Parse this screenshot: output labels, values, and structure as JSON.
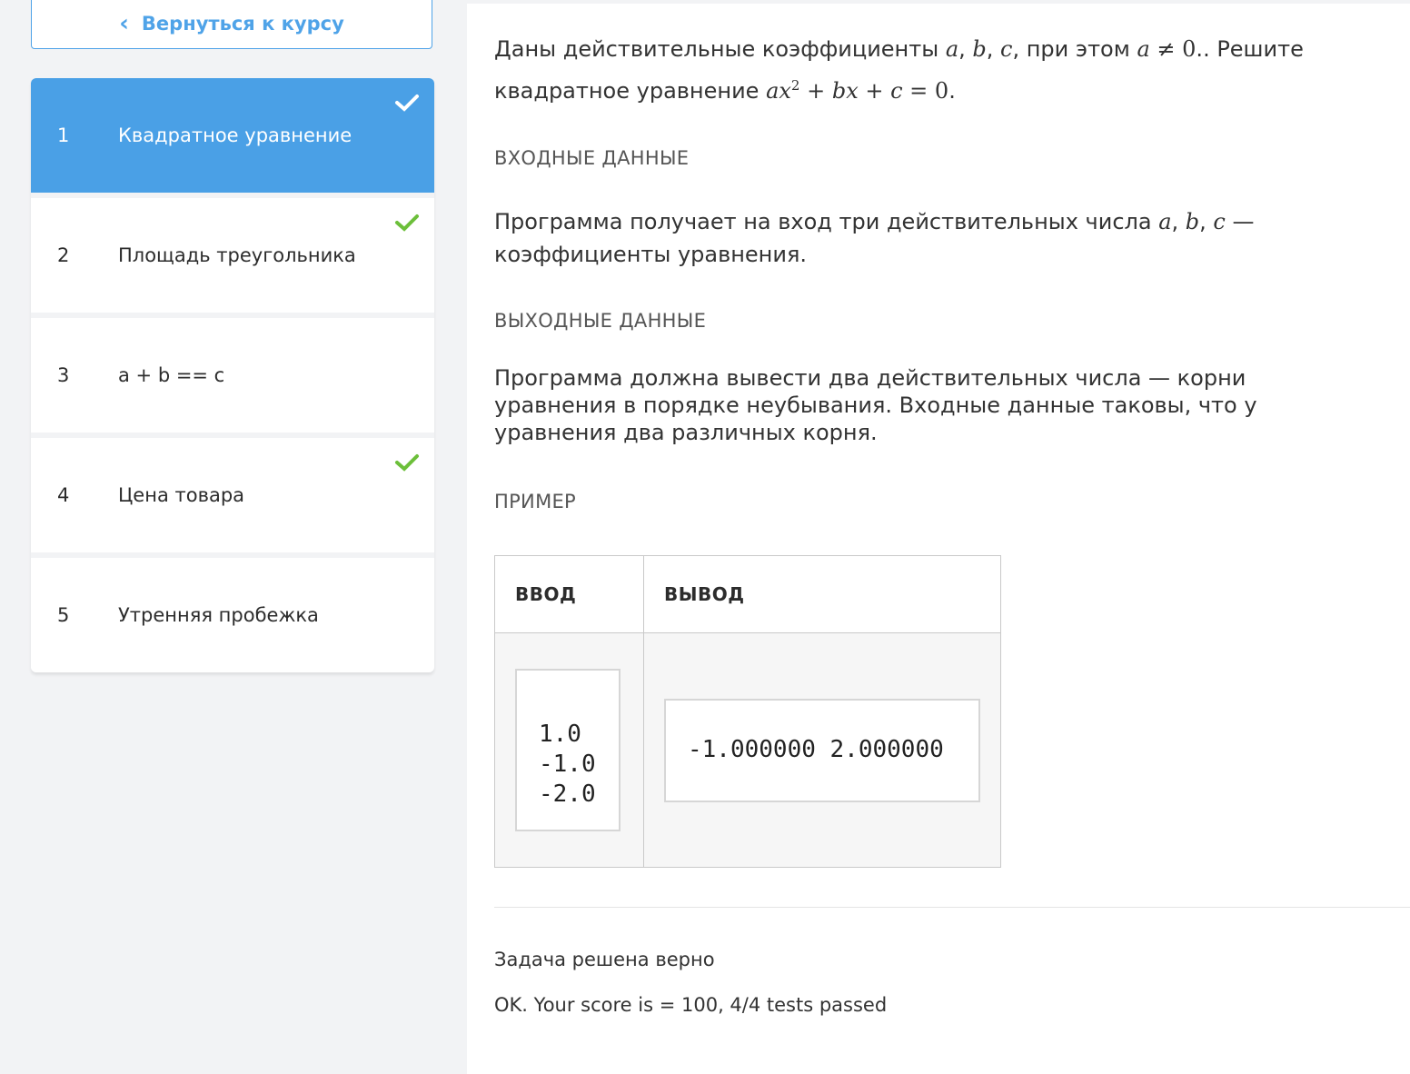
{
  "sidebar": {
    "back_label": "Вернуться к курсу",
    "items": [
      {
        "num": "1",
        "title": "Квадратное уравнение",
        "done": true,
        "active": true
      },
      {
        "num": "2",
        "title": "Площадь треугольника",
        "done": true,
        "active": false
      },
      {
        "num": "3",
        "title": "a + b == c",
        "done": false,
        "active": false
      },
      {
        "num": "4",
        "title": "Цена товара",
        "done": true,
        "active": false
      },
      {
        "num": "5",
        "title": "Утренняя пробежка",
        "done": false,
        "active": false
      }
    ]
  },
  "problem": {
    "statement_prefix": "Даны действительные коэффициенты ",
    "statement_mid": ", при этом ",
    "statement_suffix": ". Решите квадратное уравнение ",
    "input_title": "ВХОДНЫЕ ДАННЫЕ",
    "input_text_prefix": "Программа получает на вход три действительных числа ",
    "input_text_suffix": " — коэффициенты уравнения.",
    "output_title": "ВЫХОДНЫЕ ДАННЫЕ",
    "output_text": "Программа должна вывести два действительных числа — корни уравнения в порядке неубывания. Входные данные таковы, что у уравнения два различных корня.",
    "example_title": "ПРИМЕР",
    "example": {
      "col_in": "ВВОД",
      "col_out": "ВЫВОД",
      "input": "1.0\n-1.0\n-2.0",
      "output": "-1.000000 2.000000"
    }
  },
  "result": {
    "title": "Задача решена верно",
    "message": "OK. Your score is = 100, 4/4 tests passed"
  },
  "colors": {
    "accent": "#4aa0e6",
    "check_green": "#6cbf3a"
  }
}
